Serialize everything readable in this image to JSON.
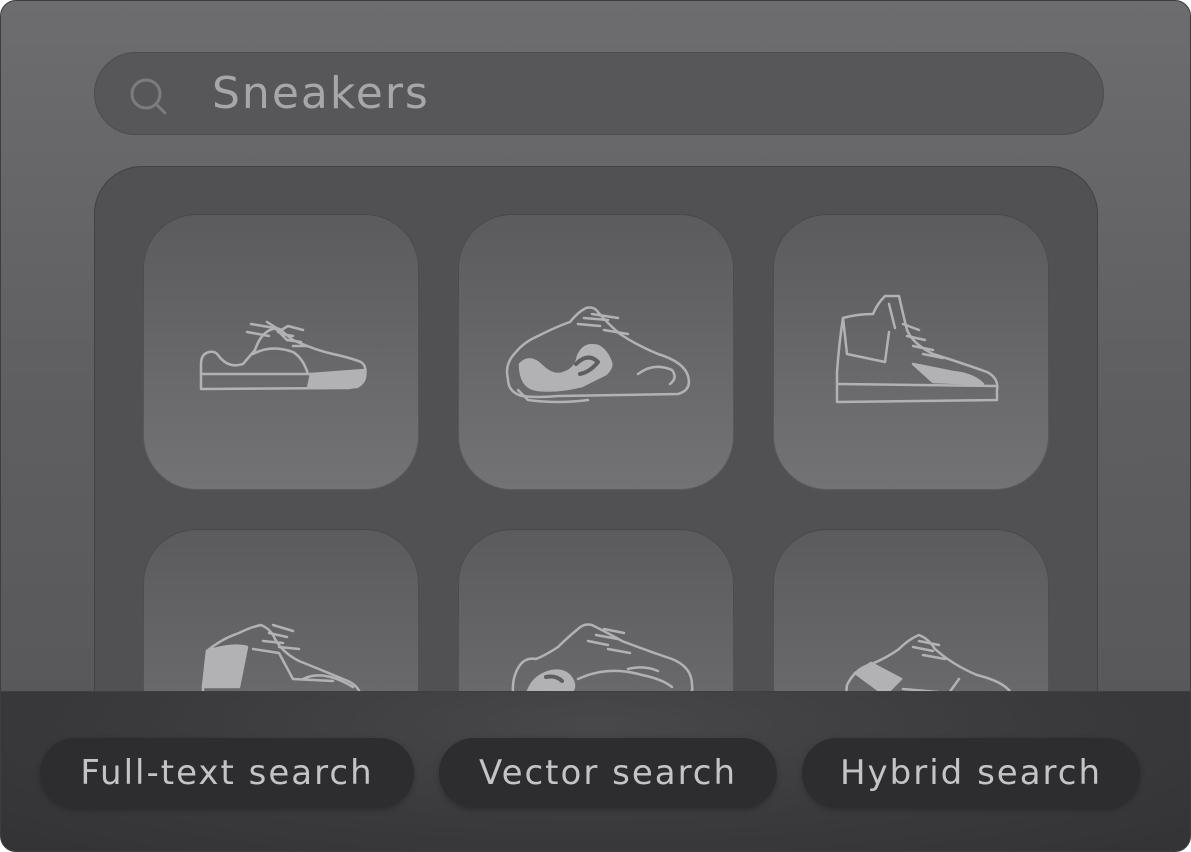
{
  "search": {
    "query": "Sneakers",
    "icon": "search-icon"
  },
  "results": {
    "items": [
      {
        "name": "low-top-sneaker-icon"
      },
      {
        "name": "chunky-runner-sneaker-icon"
      },
      {
        "name": "high-top-sneaker-icon"
      },
      {
        "name": "mid-top-sneaker-icon"
      },
      {
        "name": "retro-runner-sneaker-icon"
      },
      {
        "name": "strap-sneaker-icon"
      }
    ]
  },
  "search_modes": [
    {
      "label": "Full-text search"
    },
    {
      "label": "Vector search"
    },
    {
      "label": "Hybrid search"
    }
  ],
  "colors": {
    "window_bg": "#6d6d6f",
    "panel_bg": "#515153",
    "card_bg": "#676769",
    "line_art": "#b2b2b4",
    "pill_bg": "#2d2d2f",
    "pill_text": "#c4c4c6"
  }
}
